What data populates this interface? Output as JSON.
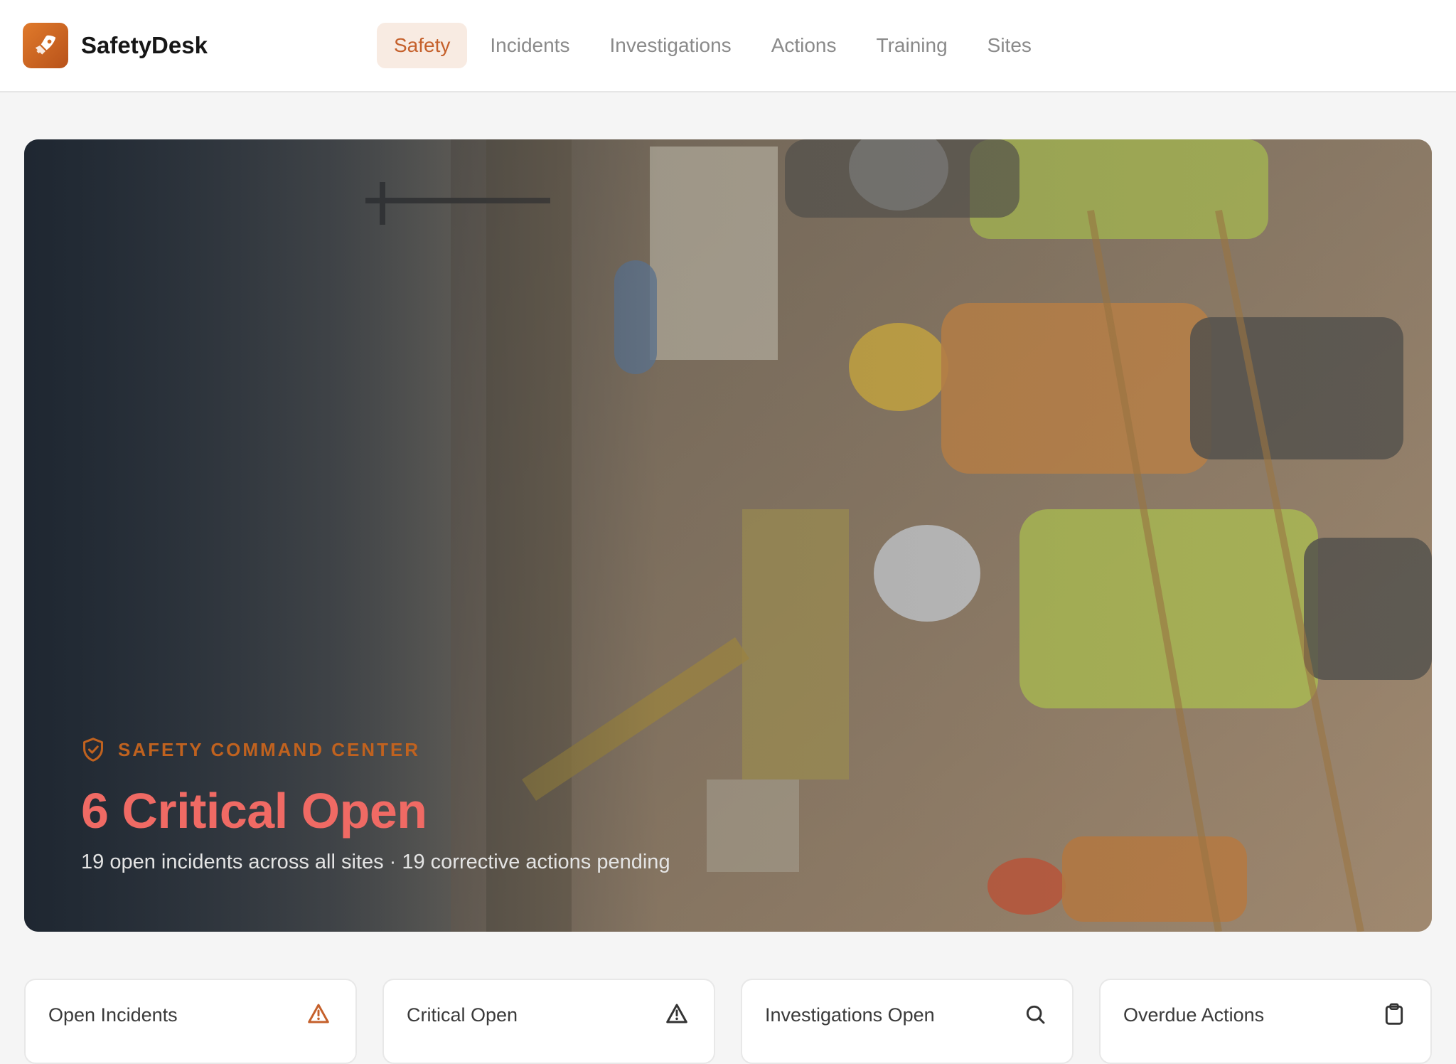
{
  "brand": {
    "name": "SafetyDesk",
    "accent": "#c5602b"
  },
  "nav": {
    "items": [
      "Safety",
      "Incidents",
      "Investigations",
      "Actions",
      "Training",
      "Sites"
    ],
    "active": "Safety"
  },
  "hero": {
    "eyebrow": "SAFETY COMMAND CENTER",
    "title": "6 Critical Open",
    "subtitle": "19 open incidents across all sites · 19 corrective actions pending"
  },
  "cards": [
    {
      "label": "Open Incidents",
      "icon": "warning-triangle-icon",
      "icon_color": "#c5602b"
    },
    {
      "label": "Critical Open",
      "icon": "alert-triangle-icon",
      "icon_color": "#333333"
    },
    {
      "label": "Investigations Open",
      "icon": "search-icon",
      "icon_color": "#333333"
    },
    {
      "label": "Overdue Actions",
      "icon": "clipboard-icon",
      "icon_color": "#333333"
    }
  ]
}
